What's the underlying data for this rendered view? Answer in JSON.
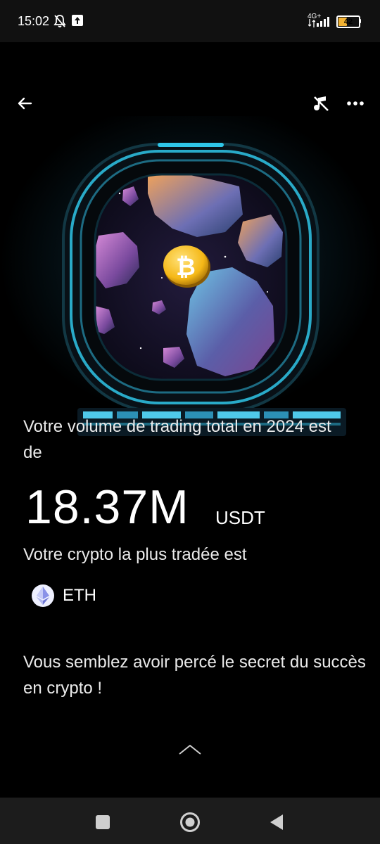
{
  "status_bar": {
    "time": "15:02",
    "network": "4G+",
    "battery": "42",
    "battery_level": 0.42
  },
  "toolbar": {
    "back_icon": "arrow-left-icon",
    "music_icon": "music-muted-icon",
    "more_icon": "more-dots-icon"
  },
  "hero": {
    "icon": "bitcoin-coin-icon",
    "accent": "#2fc6e8",
    "coin_color": "#f5b817"
  },
  "summary": {
    "headline": "Votre volume de trading total en 2024 est de",
    "volume": "18.37M",
    "unit": "USDT",
    "top_crypto_label": "Votre crypto la plus tradée est",
    "top_crypto": "ETH",
    "top_crypto_icon": "ethereum-icon",
    "closing": "Vous semblez avoir percé le secret du succès en crypto !"
  },
  "navigation": {
    "recent_icon": "square-recent-icon",
    "home_icon": "circle-home-icon",
    "back_icon": "triangle-back-icon",
    "scroll_up_icon": "chevron-up-icon"
  }
}
